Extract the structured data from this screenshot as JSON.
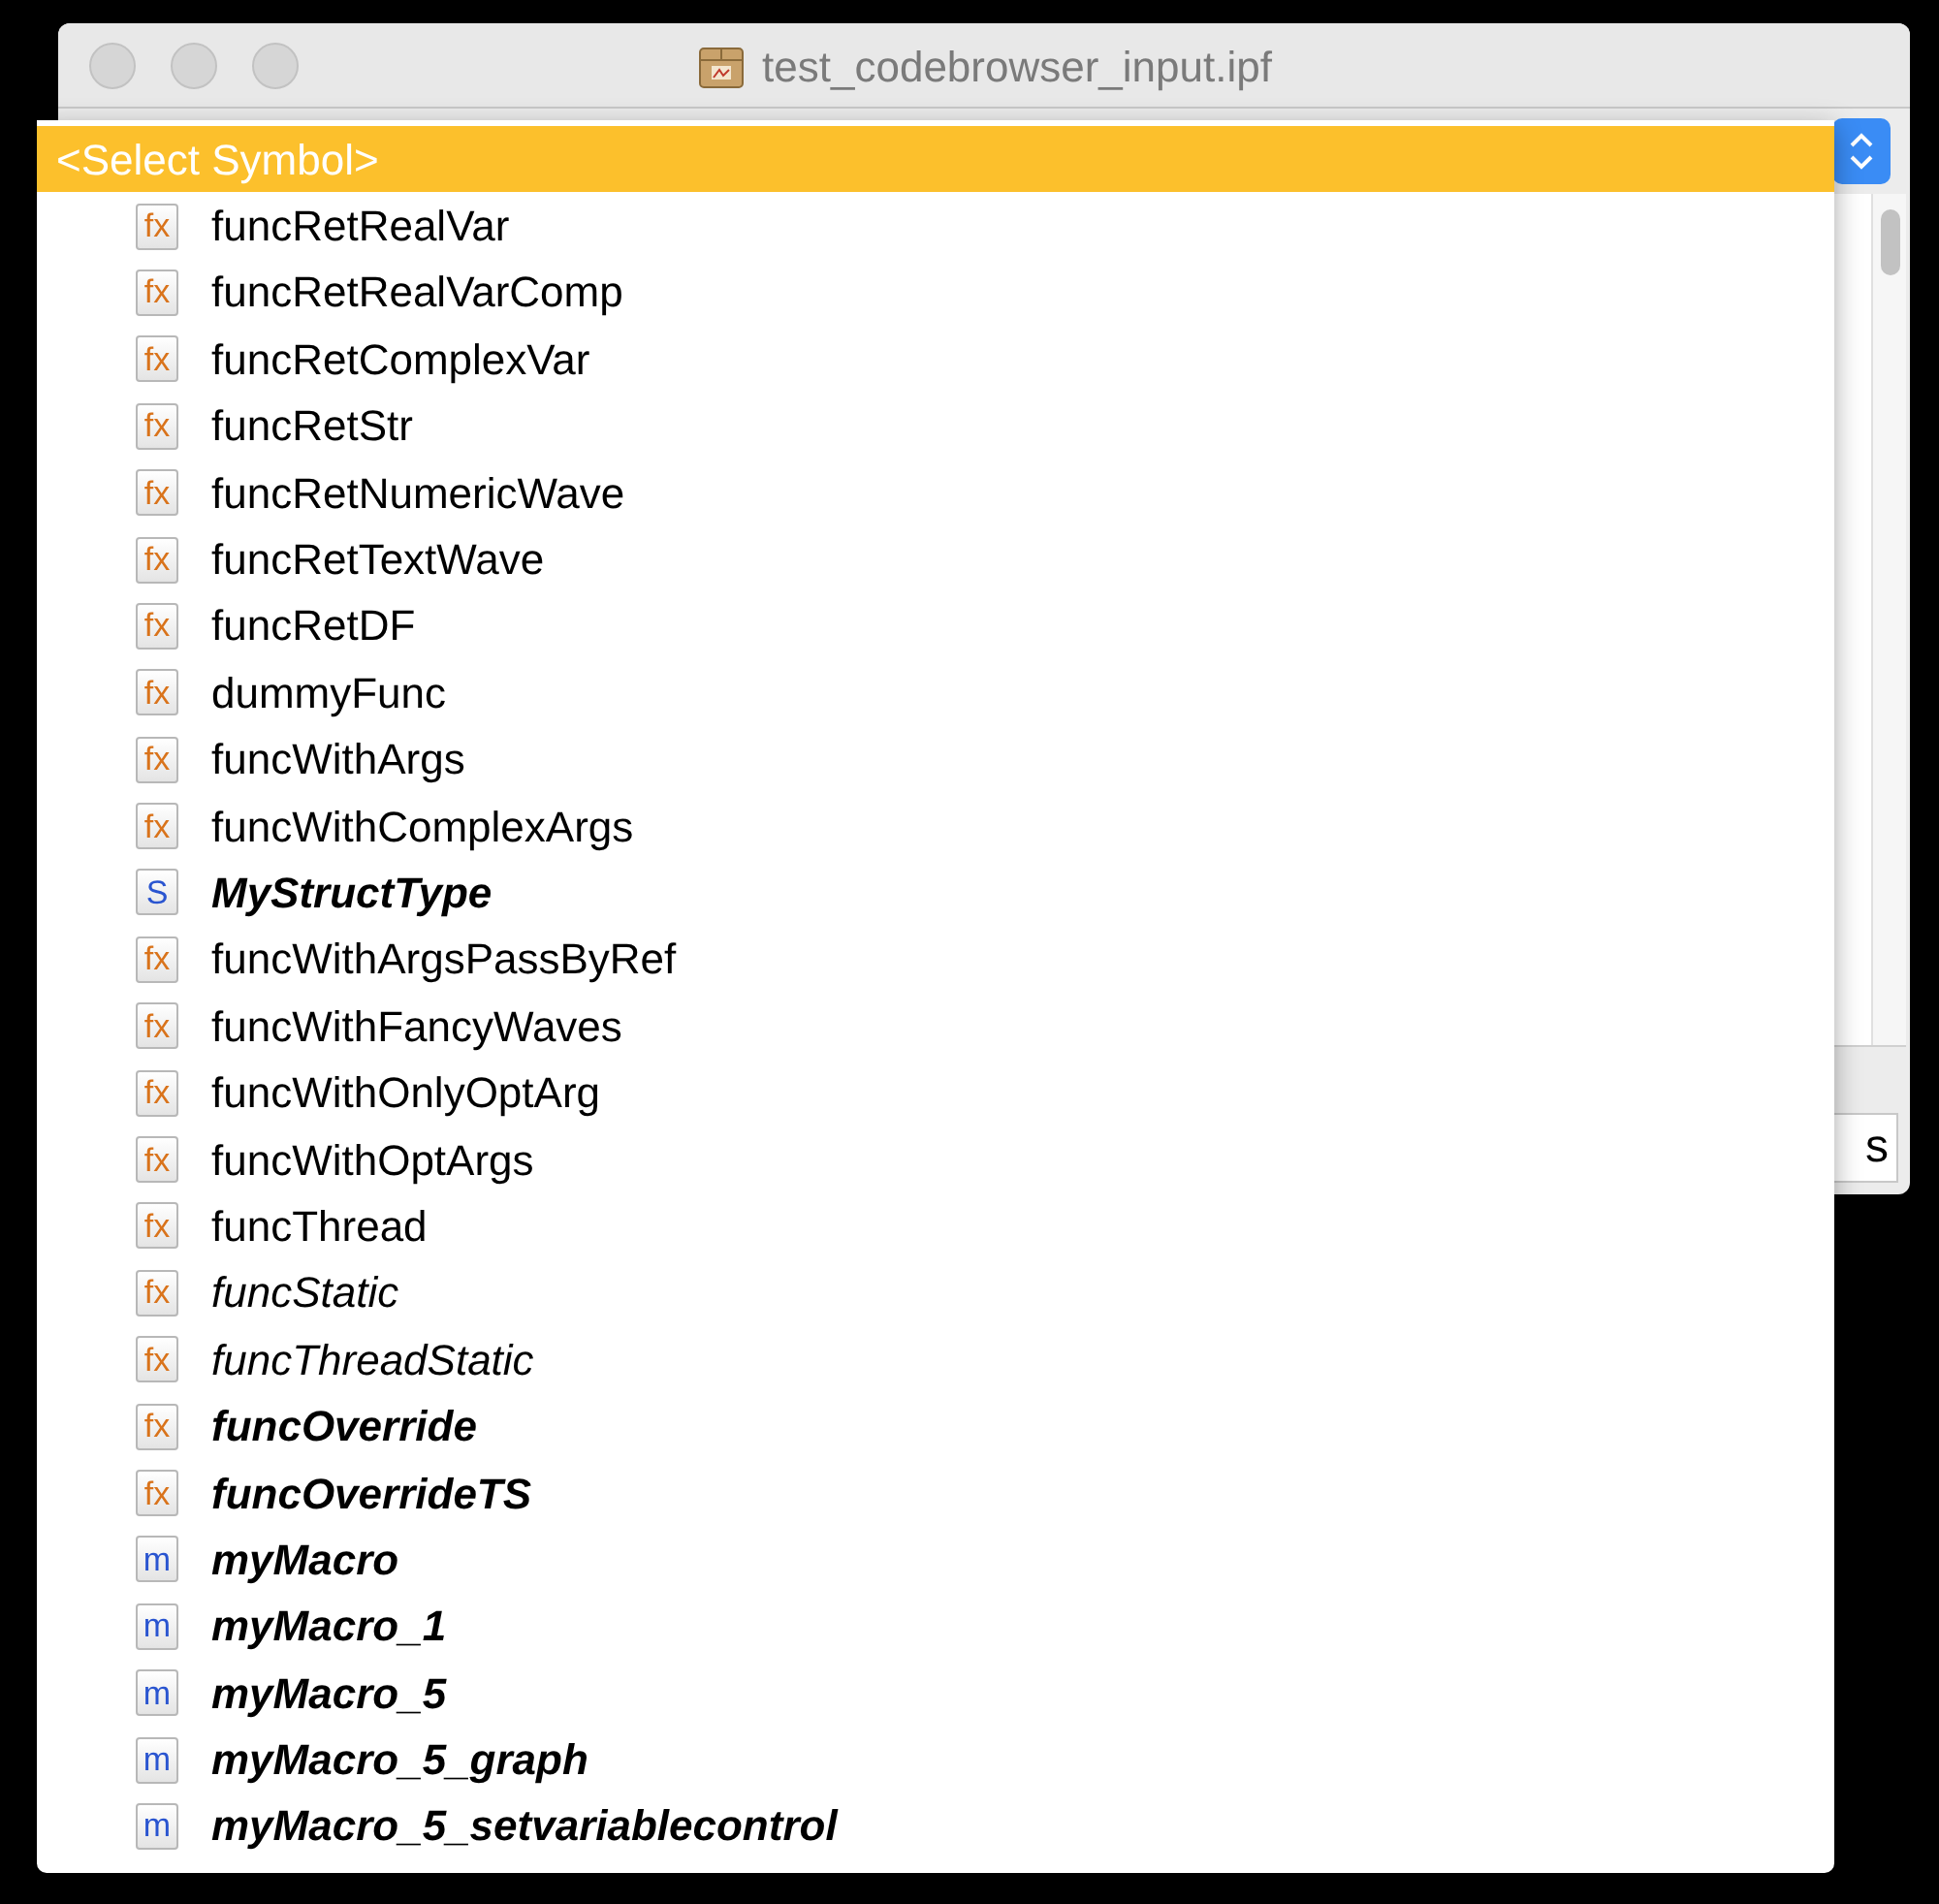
{
  "window": {
    "title": "test_codebrowser_input.ipf"
  },
  "status": {
    "text": "s"
  },
  "menu": {
    "items": [
      {
        "label": "<Select Symbol>",
        "kind": "placeholder",
        "bold": false,
        "italic": false,
        "selected": true
      },
      {
        "label": "funcRetRealVar",
        "kind": "function",
        "icon": "fx",
        "bold": false,
        "italic": false,
        "selected": false
      },
      {
        "label": "funcRetRealVarComp",
        "kind": "function",
        "icon": "fx",
        "bold": false,
        "italic": false,
        "selected": false
      },
      {
        "label": "funcRetComplexVar",
        "kind": "function",
        "icon": "fx",
        "bold": false,
        "italic": false,
        "selected": false
      },
      {
        "label": "funcRetStr",
        "kind": "function",
        "icon": "fx",
        "bold": false,
        "italic": false,
        "selected": false
      },
      {
        "label": "funcRetNumericWave",
        "kind": "function",
        "icon": "fx",
        "bold": false,
        "italic": false,
        "selected": false
      },
      {
        "label": "funcRetTextWave",
        "kind": "function",
        "icon": "fx",
        "bold": false,
        "italic": false,
        "selected": false
      },
      {
        "label": "funcRetDF",
        "kind": "function",
        "icon": "fx",
        "bold": false,
        "italic": false,
        "selected": false
      },
      {
        "label": "dummyFunc",
        "kind": "function",
        "icon": "fx",
        "bold": false,
        "italic": false,
        "selected": false
      },
      {
        "label": "funcWithArgs",
        "kind": "function",
        "icon": "fx",
        "bold": false,
        "italic": false,
        "selected": false
      },
      {
        "label": "funcWithComplexArgs",
        "kind": "function",
        "icon": "fx",
        "bold": false,
        "italic": false,
        "selected": false
      },
      {
        "label": "MyStructType",
        "kind": "structure",
        "icon": "S",
        "bold": true,
        "italic": true,
        "selected": false
      },
      {
        "label": "funcWithArgsPassByRef",
        "kind": "function",
        "icon": "fx",
        "bold": false,
        "italic": false,
        "selected": false
      },
      {
        "label": "funcWithFancyWaves",
        "kind": "function",
        "icon": "fx",
        "bold": false,
        "italic": false,
        "selected": false
      },
      {
        "label": "funcWithOnlyOptArg",
        "kind": "function",
        "icon": "fx",
        "bold": false,
        "italic": false,
        "selected": false
      },
      {
        "label": "funcWithOptArgs",
        "kind": "function",
        "icon": "fx",
        "bold": false,
        "italic": false,
        "selected": false
      },
      {
        "label": "funcThread",
        "kind": "function",
        "icon": "fx",
        "bold": false,
        "italic": false,
        "selected": false
      },
      {
        "label": "funcStatic",
        "kind": "function",
        "icon": "fx",
        "bold": false,
        "italic": true,
        "selected": false
      },
      {
        "label": "funcThreadStatic",
        "kind": "function",
        "icon": "fx",
        "bold": false,
        "italic": true,
        "selected": false
      },
      {
        "label": "funcOverride",
        "kind": "function",
        "icon": "fx",
        "bold": true,
        "italic": true,
        "selected": false
      },
      {
        "label": "funcOverrideTS",
        "kind": "function",
        "icon": "fx",
        "bold": true,
        "italic": true,
        "selected": false
      },
      {
        "label": "myMacro",
        "kind": "macro",
        "icon": "m",
        "bold": true,
        "italic": true,
        "selected": false
      },
      {
        "label": "myMacro_1",
        "kind": "macro",
        "icon": "m",
        "bold": true,
        "italic": true,
        "selected": false
      },
      {
        "label": "myMacro_5",
        "kind": "macro",
        "icon": "m",
        "bold": true,
        "italic": true,
        "selected": false
      },
      {
        "label": "myMacro_5_graph",
        "kind": "macro",
        "icon": "m",
        "bold": true,
        "italic": true,
        "selected": false
      },
      {
        "label": "myMacro_5_setvariablecontrol",
        "kind": "macro",
        "icon": "m",
        "bold": true,
        "italic": true,
        "selected": false
      }
    ]
  }
}
